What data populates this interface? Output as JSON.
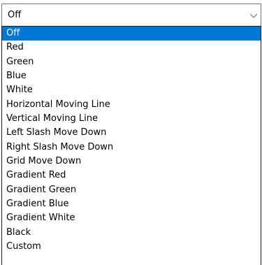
{
  "combo": {
    "value": "Off",
    "arrow_icon": "chevron-down-icon"
  },
  "list": {
    "selected_index": 0,
    "selected_color": "#0078d7",
    "options": [
      "Off",
      "Red",
      "Green",
      "Blue",
      "White",
      "Horizontal Moving Line",
      "Vertical Moving Line",
      "Left Slash Move Down",
      "Right Slash Move Down",
      "Grid Move Down",
      "Gradient Red",
      "Gradient Green",
      "Gradient Blue",
      "Gradient White",
      "Black",
      "Custom"
    ]
  }
}
